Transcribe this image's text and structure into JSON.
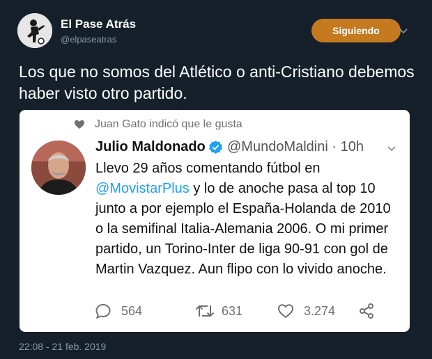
{
  "author": {
    "name": "El Pase Atrás",
    "handle": "@elpaseatras",
    "follow_label": "Siguiendo"
  },
  "tweet": {
    "text": "Los que no somos del Atlético o anti-Cristiano debemos haber visto otro partido."
  },
  "quoted": {
    "liked_by": "Juan Gato indicó que le gusta",
    "name": "Julio Maldonado",
    "handle": "@MundoMaldini",
    "sep": "·",
    "time": "10h",
    "body_before": "Llevo 29 años comentando fútbol en ",
    "mention": "@MovistarPlus",
    "body_after": " y lo de anoche pasa al top 10 junto a por ejemplo el España-Holanda de 2010 o la semifinal Italia-Alemania 2006. O mi primer partido, un Torino-Inter de liga 90-91 con gol de Martin Vazquez. Aun flipo con lo vivido anoche.",
    "replies": "564",
    "retweets": "631",
    "likes": "3.274"
  },
  "timestamp": "22:08 - 21 feb. 2019",
  "colors": {
    "background": "#15202b",
    "follow_button": "#c57a1f",
    "mention": "#1da1f2",
    "verified": "#1da1f2"
  },
  "icons": [
    "chevron-down-icon",
    "heart-icon",
    "verified-icon",
    "reply-icon",
    "retweet-icon",
    "like-icon",
    "share-icon"
  ]
}
